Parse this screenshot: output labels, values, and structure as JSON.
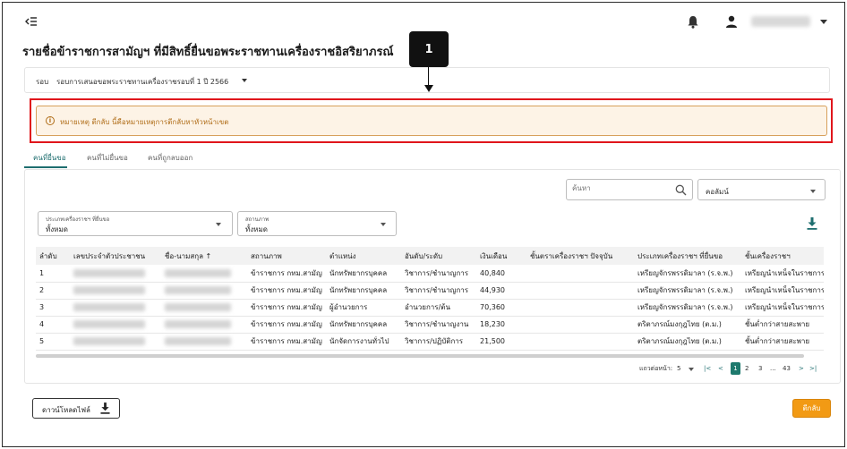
{
  "page": {
    "title": "รายชื่อข้าราชการสามัญฯ ที่มีสิทธิ์ยื่นขอพระราชทานเครื่องราชอิสริยาภรณ์"
  },
  "callout": {
    "number": "1"
  },
  "round": {
    "label": "รอบ",
    "value": "รอบการเสนอขอพระราชทานเครื่องราชรอบที่ 1 ปี 2566"
  },
  "note": {
    "text": "หมายเหตุ ตีกลับ นี้คือหมายเหตุการตีกลับหาหัวหน้าเขต"
  },
  "tabs": [
    {
      "label": "คนที่ยื่นขอ",
      "active": true
    },
    {
      "label": "คนที่ไม่ยื่นขอ",
      "active": false
    },
    {
      "label": "คนที่ถูกลบออก",
      "active": false
    }
  ],
  "search": {
    "placeholder": "ค้นหา"
  },
  "column_select": {
    "label": "คอลัมน์"
  },
  "filters": [
    {
      "label": "ประเภทเครื่องราชฯ ที่ยื่นขอ",
      "value": "ทั้งหมด"
    },
    {
      "label": "สถานภาพ",
      "value": "ทั้งหมด"
    }
  ],
  "table": {
    "columns": [
      "ลำดับ",
      "เลขประจำตัวประชาชน",
      "ชื่อ-นามสกุล ↑",
      "สถานภาพ",
      "ตำแหน่ง",
      "อันดับ/ระดับ",
      "เงินเดือน",
      "ชั้นตราเครื่องราชฯ ปัจจุบัน",
      "ประเภทเครื่องราชฯ ที่ยื่นขอ",
      "ชั้นเครื่องราชฯ"
    ],
    "rows": [
      [
        "1",
        "",
        "",
        "ข้าราชการ กทม.สามัญ",
        "นักทรัพยากรบุคคล",
        "วิชาการ/ชำนาญการ",
        "40,840",
        "",
        "เหรียญจักรพรรดิมาลา (ร.จ.พ.)",
        "เหรียญนำเหน็จในราชการ"
      ],
      [
        "2",
        "",
        "",
        "ข้าราชการ กทม.สามัญ",
        "นักทรัพยากรบุคคล",
        "วิชาการ/ชำนาญการ",
        "44,930",
        "",
        "เหรียญจักรพรรดิมาลา (ร.จ.พ.)",
        "เหรียญนำเหน็จในราชการ"
      ],
      [
        "3",
        "",
        "",
        "ข้าราชการ กทม.สามัญ",
        "ผู้อำนวยการ",
        "อำนวยการ/ต้น",
        "70,360",
        "",
        "เหรียญจักรพรรดิมาลา (ร.จ.พ.)",
        "เหรียญนำเหน็จในราชการ"
      ],
      [
        "4",
        "",
        "",
        "ข้าราชการ กทม.สามัญ",
        "นักทรัพยากรบุคคล",
        "วิชาการ/ชำนาญงาน",
        "18,230",
        "",
        "ตริตาภรณ์มงกุฎไทย (ต.ม.)",
        "ชั้นต่ำกว่าสายสะพาย"
      ],
      [
        "5",
        "",
        "",
        "ข้าราชการ กทม.สามัญ",
        "นักจัดการงานทั่วไป",
        "วิชาการ/ปฏิบัติการ",
        "21,500",
        "",
        "ตริตาภรณ์มงกุฎไทย (ต.ม.)",
        "ชั้นต่ำกว่าสายสะพาย"
      ]
    ]
  },
  "pagination": {
    "rows_per_page_label": "แถวต่อหน้า:",
    "rows_per_page": "5",
    "first": "|<",
    "prev": "<",
    "pages": [
      "1",
      "2",
      "3",
      "...",
      "43"
    ],
    "next": ">",
    "last": ">|"
  },
  "buttons": {
    "download": "ดาวน์โหลดไฟล์",
    "back": "ตีกลับ"
  },
  "colors": {
    "accent": "#1e6e6f",
    "highlight": "#e0161c",
    "note_bg": "#fdf3e6",
    "note_text": "#b06d18",
    "back_button": "#f29a14"
  }
}
